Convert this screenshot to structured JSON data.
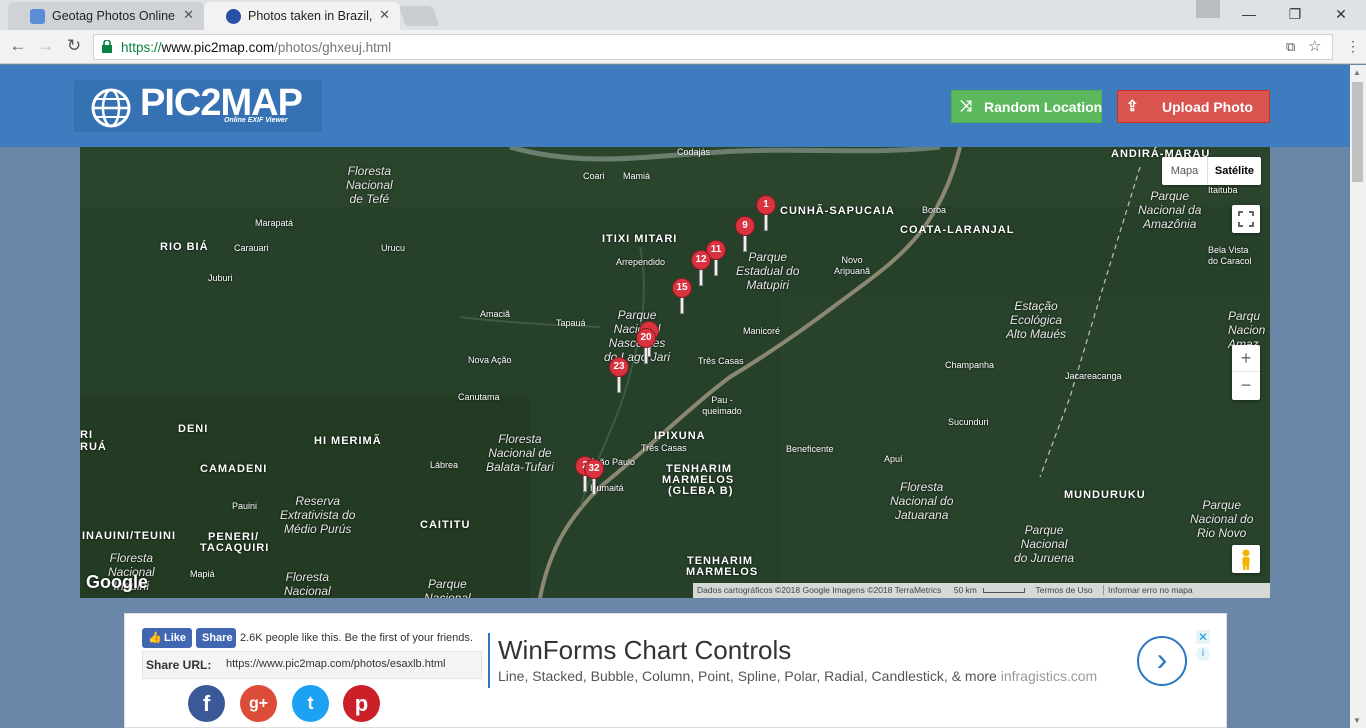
{
  "browser": {
    "tabs": [
      {
        "title": "Geotag Photos Online",
        "active": false
      },
      {
        "title": "Photos taken in Brazil, us",
        "active": true
      }
    ],
    "url_prefix": "https://",
    "url_domain": "www.pic2map.com",
    "url_path": "/photos/ghxeuj.html"
  },
  "header": {
    "logo_text": "PIC2MAP",
    "logo_tagline": "Online EXIF Viewer",
    "random_label": "Random Location",
    "upload_label": "Upload Photo"
  },
  "map": {
    "type_options": [
      "Mapa",
      "Satélite"
    ],
    "selected_type": "Satélite",
    "zoom_in": "+",
    "zoom_out": "−",
    "google_logo": "Google",
    "attribution": "Dados cartográficos ©2018 Google Imagens ©2018 TerraMetrics",
    "scale": "50 km",
    "terms": "Termos de Uso",
    "report": "Informar erro no mapa",
    "markers": [
      "1",
      "9",
      "11",
      "12",
      "15",
      "20",
      "23",
      "2",
      "32"
    ],
    "labels": {
      "codajas": "Codajás",
      "coari": "Coari",
      "mamia": "Mamiá",
      "marapata": "Marapatá",
      "carauari": "Carauari",
      "urucu": "Urucu",
      "jubui": "Juburi",
      "arrependido": "Arrependido",
      "amacia": "Amaciã",
      "tapaua": "Tapauá",
      "nova_acao": "Nova Ação",
      "canutama": "Canutama",
      "manicore": "Manicoré",
      "tres_casas": "Três Casas",
      "pau_queimado": "Pau - queimado",
      "tres_casas2": "Três Casas",
      "beneficente": "Beneficente",
      "labrea": "Lábrea",
      "joao_paulo": "João Paulo",
      "humaita": "Humaitá",
      "pauini": "Pauini",
      "mapia": "Mapiá",
      "borba": "Borba",
      "novo_aripuana": "Novo Aripuanã",
      "itaituba": "Itaituba",
      "bela_vista": "Bela Vista do Caracol",
      "champanha": "Champanha",
      "jacareacanga": "Jacareacanga",
      "sucunduri": "Sucunduri",
      "apui": "Apuí"
    },
    "areas": {
      "rio_bia": "RIO BIÁ",
      "itixi": "ITIXI MITARI",
      "cunha": "CUNHÃ-SAPUCAIA",
      "coata": "COATA-LARANJAL",
      "andira": "ANDIRÁ-MARAU",
      "deni": "DENI",
      "hi_merima": "HI MERIMÃ",
      "camadeni": "CAMADENI",
      "ipixuna": "IPIXUNA",
      "tenharim1": "TENHARIM",
      "tenharim1b": "MARMELOS",
      "tenharim1c": "(GLEBA B)",
      "caititu": "CAITITU",
      "inauini": "INAUINI/TEUINI",
      "peneri1": "PENERI/",
      "peneri2": "TACAQUIRI",
      "munduruku": "MUNDURUKU",
      "tenharim2": "TENHARIM",
      "tenharim2b": "MARMELOS",
      "left_cut1": "RI",
      "left_cut2": "RUÁ"
    },
    "parks": {
      "tefe": "Floresta\nNacional\nde Tefé",
      "matupiri": "Parque\nEstadual do\nMatupiri",
      "amazonia": "Parque\nNacional da\nAmazônia",
      "lago_jari": "Parque\nNacional\nNascentes\ndo Lago Jari",
      "alto_maues": "Estação\nEcológica\nAlto Maués",
      "balata": "Floresta\nNacional de\nBalata-Tufari",
      "medio_purus": "Reserva\nExtrativista do\nMédio Purús",
      "jatuarana": "Floresta\nNacional do\nJatuarana",
      "rio_novo": "Parque\nNacional do\nRio Novo",
      "juruena": "Parque\nNacional\ndo Juruena",
      "inauini_f": "Floresta\nNacional\nInauini",
      "floresta_bottom": "Floresta\nNacional",
      "parque_bottom": "Parque\nNacional",
      "parque_right": "Parqu\nNacion\nAmaz"
    }
  },
  "social": {
    "like_label": "Like",
    "share_label": "Share",
    "like_text": "2.6K people like this. Be the first of your friends.",
    "share_url_label": "Share URL:",
    "share_url": "https://www.pic2map.com/photos/esaxlb.html"
  },
  "ad": {
    "title": "WinForms Chart Controls",
    "subtitle": "Line, Stacked, Bubble, Column, Point, Spline, Polar, Radial, Candlestick, & more",
    "sponsor": "infragistics.com"
  }
}
